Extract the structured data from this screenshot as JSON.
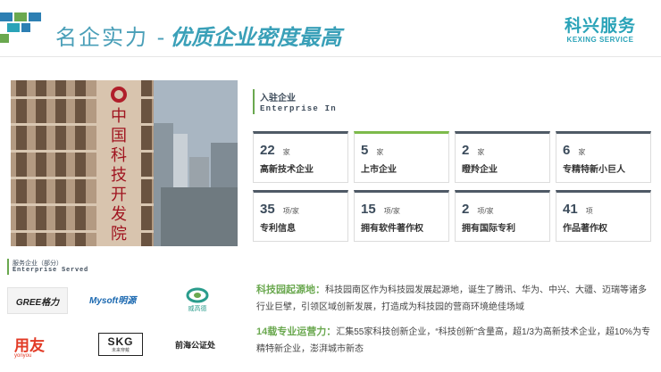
{
  "header": {
    "title_main": "名企实力 -",
    "title_sub": "优质企业密度最高",
    "brand_cn": "科兴服务",
    "brand_en": "KEXING SERVICE"
  },
  "photo": {
    "building_sign": [
      "中",
      "国",
      "科",
      "技",
      "开",
      "发",
      "院"
    ]
  },
  "enterprise_in": {
    "title_cn": "入驻企业",
    "title_en": "Enterprise In",
    "cards": [
      {
        "num": "22",
        "unit": "家",
        "label": "高新技术企业",
        "accent": "dark"
      },
      {
        "num": "5",
        "unit": "家",
        "label": "上市企业",
        "accent": "green"
      },
      {
        "num": "2",
        "unit": "家",
        "label": "瞪羚企业",
        "accent": "dark"
      },
      {
        "num": "6",
        "unit": "家",
        "label": "专精特新小巨人",
        "accent": "dark"
      },
      {
        "num": "35",
        "unit": "项/家",
        "label": "专利信息",
        "accent": "dark"
      },
      {
        "num": "15",
        "unit": "项/家",
        "label": "拥有软件著作权",
        "accent": "dark"
      },
      {
        "num": "2",
        "unit": "项/家",
        "label": "拥有国际专利",
        "accent": "dark"
      },
      {
        "num": "41",
        "unit": "项",
        "label": "作品著作权",
        "accent": "dark"
      }
    ]
  },
  "served": {
    "title_cn": "服务企业（部分）",
    "title_en": "Enterprise Served",
    "logos": {
      "gree": "GREE格力",
      "mysoft": "Mysoft明源",
      "weigao": "威高德",
      "yonyou": "用友",
      "yonyou_en": "yonyou",
      "skg": "SKG",
      "skg_sub": "未来穿戴",
      "qianhai": "前海公证处"
    }
  },
  "descriptions": [
    {
      "highlight": "科技园起源地：",
      "text": "科技园南区作为科技园发展起源地，诞生了腾讯、华为、中兴、大疆、迈瑞等诸多行业巨擘，引领区域创新发展，打造成为科技园的营商环境绝佳场域"
    },
    {
      "highlight": "14载专业运营力：",
      "text": "汇集55家科技创新企业，“科技创新”含量高，超1/3为高新技术企业，超10%为专精特新企业，澎湃城市新态"
    }
  ],
  "colors": {
    "accent_blue": "#4a9fb8",
    "accent_green": "#6aa84f",
    "card_dark": "#4f5a66"
  }
}
